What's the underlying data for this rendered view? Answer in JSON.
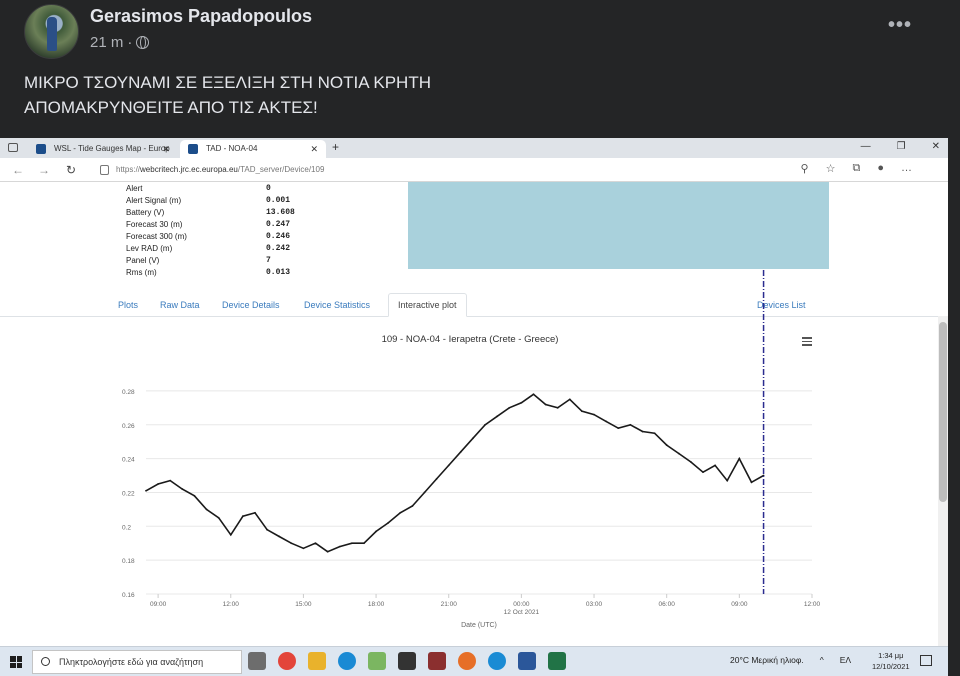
{
  "post": {
    "author": "Gerasimos Papadopoulos",
    "time": "21 m",
    "separator": "·",
    "more": "•••",
    "text_line1": "ΜΙΚΡΟ ΤΣΟΥΝΑΜΙ ΣΕ ΕΞΕΛΙΞΗ ΣΤΗ ΝΟΤΙΑ ΚΡΗΤΗ",
    "text_line2": "ΑΠΟΜΑΚΡΥΝΘΕΙΤΕ ΑΠΟ ΤΙΣ ΑΚΤΕΣ!"
  },
  "browser": {
    "tabs": [
      {
        "label": "WSL - Tide Gauges Map - Europ",
        "close": "✕"
      },
      {
        "label": "TAD - NOA-04",
        "close": "✕"
      }
    ],
    "new_tab": "+",
    "url_prefix": "https://",
    "url_host": "webcritech.jrc.ec.europa.eu",
    "url_path": "/TAD_server/Device/109",
    "window_buttons": [
      "—",
      "❐",
      "✕"
    ]
  },
  "device_values": [
    {
      "key": "Alert",
      "value": "0"
    },
    {
      "key": "Alert Signal (m)",
      "value": "0.001"
    },
    {
      "key": "Battery (V)",
      "value": "13.608"
    },
    {
      "key": "Forecast 30 (m)",
      "value": "0.247"
    },
    {
      "key": "Forecast 300 (m)",
      "value": "0.246"
    },
    {
      "key": "Lev RAD (m)",
      "value": "0.242"
    },
    {
      "key": "Panel (V)",
      "value": "7"
    },
    {
      "key": "Rms (m)",
      "value": "0.013"
    }
  ],
  "nav_tabs": {
    "plots": "Plots",
    "raw_data": "Raw Data",
    "device_details": "Device Details",
    "device_statistics": "Device Statistics",
    "interactive_plot": "Interactive plot",
    "devices_list": "Devices List"
  },
  "chart_data": {
    "type": "line",
    "title": "109 - NOA-04 - Ierapetra (Crete - Greece)",
    "xlabel": "Date (UTC)",
    "ylabel": "",
    "x_ticks": [
      "09:00",
      "12:00",
      "15:00",
      "18:00",
      "21:00",
      "00:00",
      "03:00",
      "06:00",
      "09:00",
      "12:00"
    ],
    "x_date_label": "12 Oct 2021",
    "y_ticks": [
      "0.28",
      "0.26",
      "0.24",
      "0.22",
      "0.2",
      "0.18",
      "0.16"
    ],
    "xlim": [
      "2021-10-11 08:30",
      "2021-10-12 12:00"
    ],
    "ylim": [
      0.16,
      0.29
    ],
    "series": [
      {
        "color": "#1a1a1a",
        "x": [
          "2021-10-11 08:30",
          "2021-10-11 09:00",
          "2021-10-11 09:30",
          "2021-10-11 10:00",
          "2021-10-11 10:30",
          "2021-10-11 11:00",
          "2021-10-11 11:30",
          "2021-10-11 12:00",
          "2021-10-11 12:30",
          "2021-10-11 13:00",
          "2021-10-11 13:30",
          "2021-10-11 14:00",
          "2021-10-11 14:30",
          "2021-10-11 15:00",
          "2021-10-11 15:30",
          "2021-10-11 16:00",
          "2021-10-11 16:30",
          "2021-10-11 17:00",
          "2021-10-11 17:30",
          "2021-10-11 18:00",
          "2021-10-11 18:30",
          "2021-10-11 19:00",
          "2021-10-11 19:30",
          "2021-10-11 20:00",
          "2021-10-11 20:30",
          "2021-10-11 21:00",
          "2021-10-11 21:30",
          "2021-10-11 22:00",
          "2021-10-11 22:30",
          "2021-10-11 23:00",
          "2021-10-11 23:30",
          "2021-10-12 00:00",
          "2021-10-12 00:30",
          "2021-10-12 01:00",
          "2021-10-12 01:30",
          "2021-10-12 02:00",
          "2021-10-12 02:30",
          "2021-10-12 03:00",
          "2021-10-12 03:30",
          "2021-10-12 04:00",
          "2021-10-12 04:30",
          "2021-10-12 05:00",
          "2021-10-12 05:30",
          "2021-10-12 06:00",
          "2021-10-12 06:30",
          "2021-10-12 07:00",
          "2021-10-12 07:30",
          "2021-10-12 08:00",
          "2021-10-12 08:30",
          "2021-10-12 09:00",
          "2021-10-12 09:30",
          "2021-10-12 10:00"
        ],
        "y": [
          0.221,
          0.225,
          0.227,
          0.222,
          0.218,
          0.21,
          0.205,
          0.195,
          0.206,
          0.208,
          0.198,
          0.194,
          0.19,
          0.187,
          0.19,
          0.185,
          0.188,
          0.19,
          0.19,
          0.197,
          0.202,
          0.208,
          0.212,
          0.22,
          0.228,
          0.236,
          0.244,
          0.252,
          0.26,
          0.265,
          0.27,
          0.273,
          0.278,
          0.272,
          0.27,
          0.275,
          0.268,
          0.266,
          0.262,
          0.258,
          0.26,
          0.256,
          0.255,
          0.248,
          0.243,
          0.238,
          0.232,
          0.236,
          0.227,
          0.24,
          0.226,
          0.23
        ]
      }
    ],
    "marker_line_x": "2021-10-12 10:00",
    "marker_line_color": "#2b2c8f"
  },
  "taskbar": {
    "search_placeholder": "Πληκτρολογήστε εδώ για αναζήτηση",
    "weather": "20°C  Μερική ηλιοφ.",
    "lang": "ΕΛ",
    "time": "1:34 μμ",
    "date": "12/10/2021",
    "tray_arrow": "^"
  }
}
